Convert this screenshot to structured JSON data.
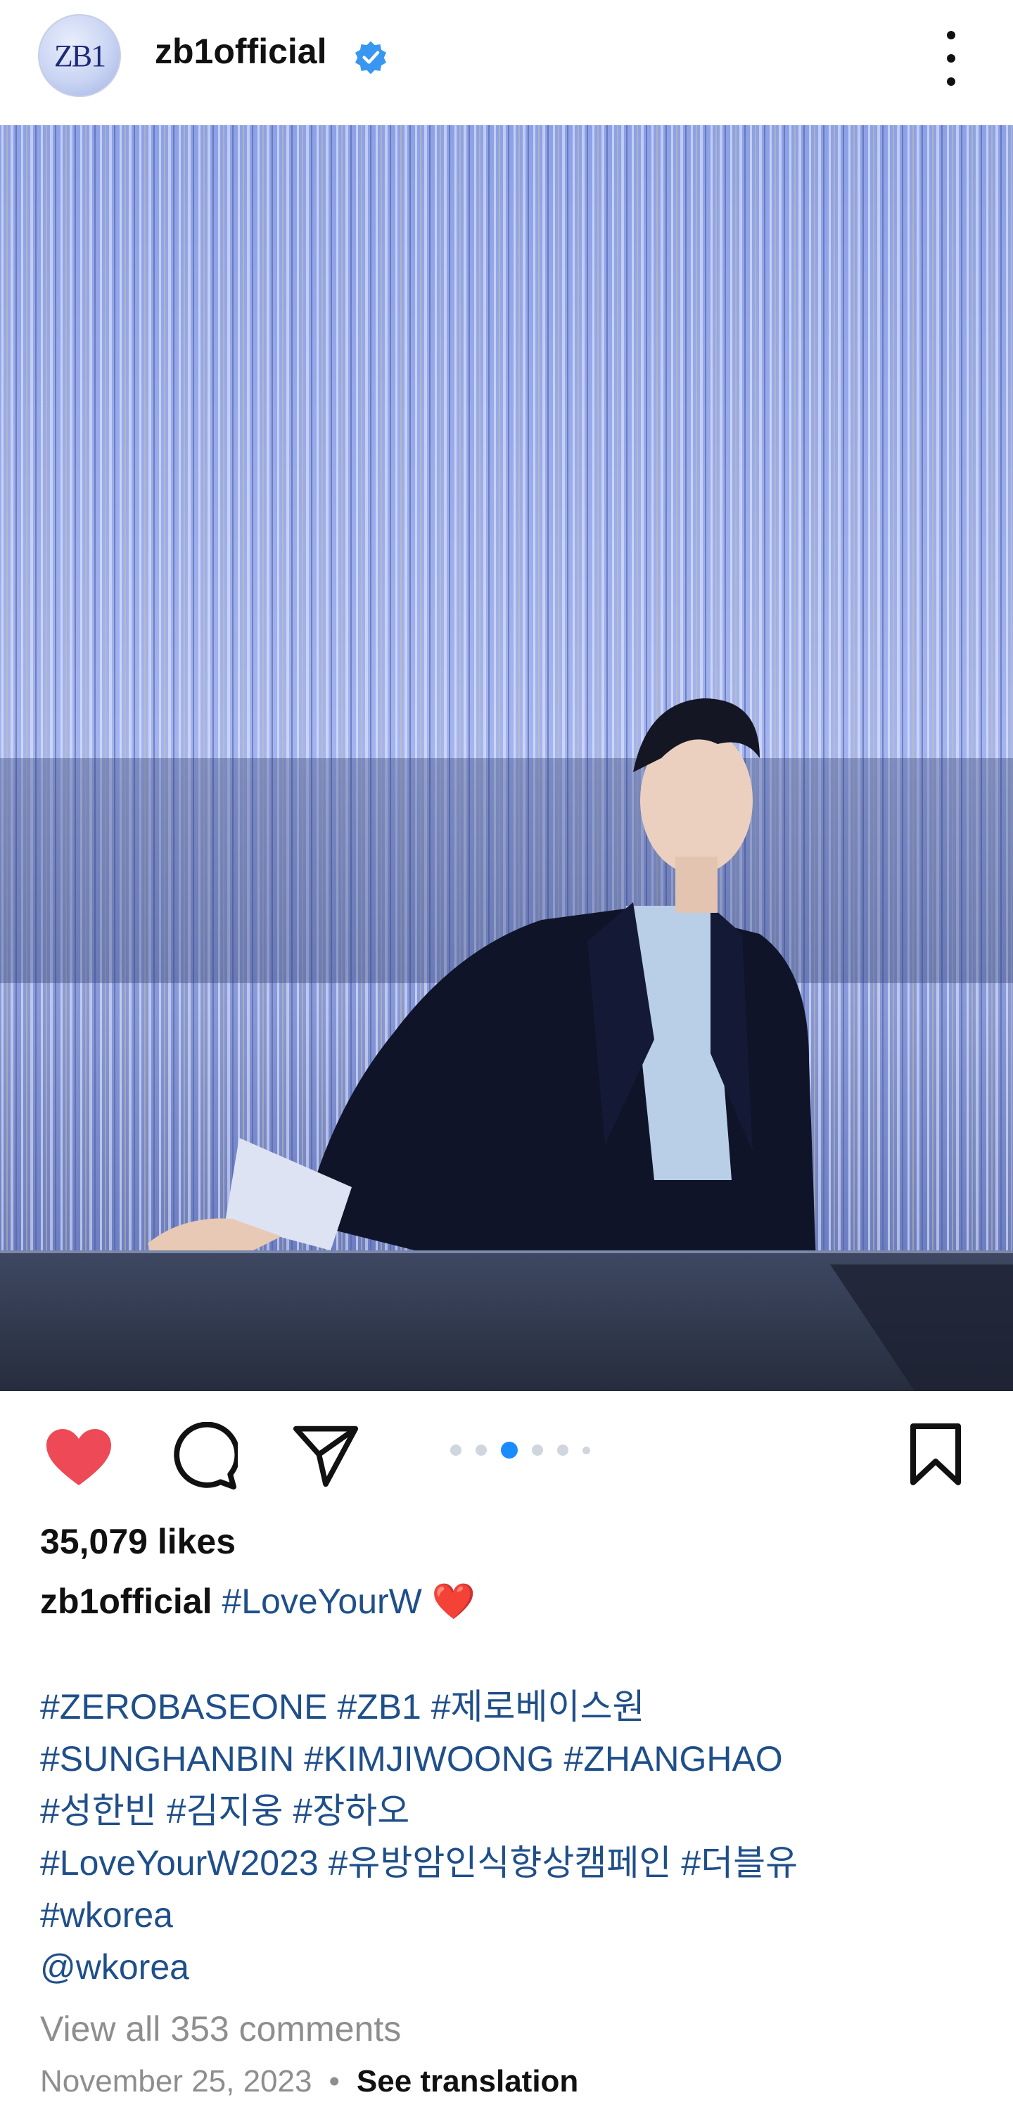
{
  "post": {
    "username": "zb1official",
    "avatar_text": "ZB1",
    "verified": true,
    "image_alt": "Person in dark blazer and light blue shirt posing in front of a silver tinsel curtain",
    "likes": "35,079 likes",
    "caption": {
      "user": "zb1official",
      "text": "#LoveYourW",
      "emoji": "❤️"
    },
    "hashtag_lines": [
      "#ZEROBASEONE #ZB1 #제로베이스원",
      "#SUNGHANBIN #KIMJIWOONG #ZHANGHAO",
      "#성한빈 #김지웅 #장하오",
      "#LoveYourW2023 #유방암인식향상캠페인 #더블유",
      "#wkorea",
      "@wkorea"
    ],
    "view_comments": "View all 353 comments",
    "date": "November 25, 2023",
    "separator": "•",
    "see_translation": "See translation"
  },
  "icons": {
    "like": "heart-icon",
    "comment": "comment-icon",
    "share": "send-icon",
    "save": "bookmark-icon",
    "more": "more-vertical-icon",
    "verified": "verified-badge-icon"
  },
  "colors": {
    "like": "#ed4956",
    "verified": "#3897f0",
    "hashtag": "#1f4f8a",
    "muted": "#8e8e8e",
    "carousel_active": "#1a8cff"
  },
  "carousel": {
    "count": 6,
    "active_index": 2
  }
}
